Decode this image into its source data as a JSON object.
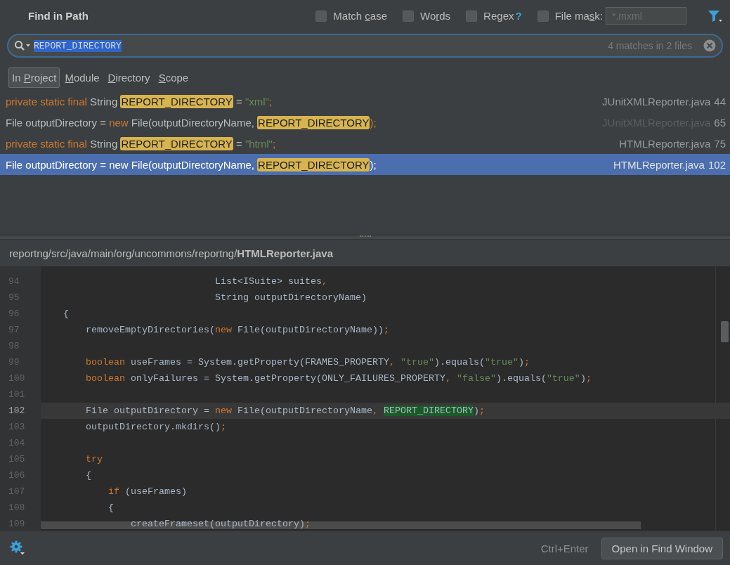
{
  "dialog": {
    "title": "Find in Path"
  },
  "options": [
    {
      "label": {
        "before": "Match ",
        "key": "c",
        "after": "ase"
      },
      "checked": false
    },
    {
      "label": {
        "before": "Wo",
        "key": "r",
        "after": "ds"
      },
      "checked": false
    },
    {
      "label": {
        "before": "Re",
        "key": "g",
        "after": "ex"
      },
      "checked": false,
      "help": "?"
    },
    {
      "label": {
        "before": "File ma",
        "key": "s",
        "after": "k:"
      },
      "checked": false
    }
  ],
  "file_mask": {
    "placeholder": "*.mxml"
  },
  "search": {
    "value": "REPORT_DIRECTORY",
    "match_count": "4 matches in 2 files"
  },
  "scopes": [
    {
      "label": {
        "before": "In ",
        "key": "P",
        "after": "roject"
      },
      "selected": true
    },
    {
      "label": {
        "key": "M",
        "after": "odule"
      },
      "selected": false
    },
    {
      "label": {
        "key": "D",
        "after": "irectory"
      },
      "selected": false
    },
    {
      "label": {
        "key": "S",
        "after": "cope"
      },
      "selected": false
    }
  ],
  "results": [
    {
      "selected": false,
      "file_dimmed": false,
      "file": "JUnitXMLReporter.java",
      "line": "44",
      "tokens": [
        {
          "kind": "keyword",
          "text": "private static final "
        },
        {
          "kind": "plain",
          "text": "String "
        },
        {
          "kind": "match",
          "text": "REPORT_DIRECTORY"
        },
        {
          "kind": "plain",
          "text": " = "
        },
        {
          "kind": "string",
          "text": "\"xml\""
        },
        {
          "kind": "punct",
          "text": ";"
        }
      ]
    },
    {
      "selected": false,
      "file_dimmed": true,
      "file": "JUnitXMLReporter.java",
      "line": "65",
      "tokens": [
        {
          "kind": "plain",
          "text": "File outputDirectory = "
        },
        {
          "kind": "keyword",
          "text": "new"
        },
        {
          "kind": "plain",
          "text": " File(outputDirectoryName, "
        },
        {
          "kind": "match",
          "text": "REPORT_DIRECTORY"
        },
        {
          "kind": "punct",
          "text": ");"
        }
      ]
    },
    {
      "selected": false,
      "file_dimmed": false,
      "file": "HTMLReporter.java",
      "line": "75",
      "tokens": [
        {
          "kind": "keyword",
          "text": "private static final "
        },
        {
          "kind": "plain",
          "text": "String "
        },
        {
          "kind": "match",
          "text": "REPORT_DIRECTORY"
        },
        {
          "kind": "plain",
          "text": " = "
        },
        {
          "kind": "string",
          "text": "\"html\""
        },
        {
          "kind": "punct",
          "text": ";"
        }
      ]
    },
    {
      "selected": true,
      "file_dimmed": false,
      "file": "HTMLReporter.java",
      "line": "102",
      "tokens": [
        {
          "kind": "plain",
          "text": "File outputDirectory = "
        },
        {
          "kind": "keyword",
          "text": "new"
        },
        {
          "kind": "plain",
          "text": " File(outputDirectoryName, "
        },
        {
          "kind": "match",
          "text": "REPORT_DIRECTORY"
        },
        {
          "kind": "punct",
          "text": ");"
        }
      ]
    }
  ],
  "preview": {
    "path": "reportng/src/java/main/org/uncommons/reportng/**HTMLReporter.java**"
  },
  "code": [
    {
      "number": "94",
      "current": false,
      "tokens": [
        {
          "kind": "plain",
          "text": "                               List<ISuite> suites"
        },
        {
          "kind": "punct",
          "text": ","
        }
      ]
    },
    {
      "number": "95",
      "current": false,
      "tokens": [
        {
          "kind": "plain",
          "text": "                               String outputDirectoryName)"
        }
      ]
    },
    {
      "number": "96",
      "current": false,
      "tokens": [
        {
          "kind": "plain",
          "text": "    {"
        }
      ]
    },
    {
      "number": "97",
      "current": false,
      "tokens": [
        {
          "kind": "plain",
          "text": "        removeEmptyDirectories("
        },
        {
          "kind": "keyword",
          "text": "new"
        },
        {
          "kind": "plain",
          "text": " File(outputDirectoryName))"
        },
        {
          "kind": "punct",
          "text": ";"
        }
      ]
    },
    {
      "number": "98",
      "current": false
    },
    {
      "number": "99",
      "current": false,
      "tokens": [
        {
          "kind": "keyword",
          "text": "        boolean"
        },
        {
          "kind": "plain",
          "text": " useFrames = System.getProperty(FRAMES_PROPERTY"
        },
        {
          "kind": "punct",
          "text": ", "
        },
        {
          "kind": "string",
          "text": "\"true\""
        },
        {
          "kind": "plain",
          "text": ").equals("
        },
        {
          "kind": "string",
          "text": "\"true\""
        },
        {
          "kind": "plain",
          "text": ")"
        },
        {
          "kind": "punct",
          "text": ";"
        }
      ]
    },
    {
      "number": "100",
      "current": false,
      "tokens": [
        {
          "kind": "keyword",
          "text": "        boolean"
        },
        {
          "kind": "plain",
          "text": " onlyFailures = System.getProperty(ONLY_FAILURES_PROPERTY"
        },
        {
          "kind": "punct",
          "text": ", "
        },
        {
          "kind": "string",
          "text": "\"false\""
        },
        {
          "kind": "plain",
          "text": ").equals("
        },
        {
          "kind": "string",
          "text": "\"true\""
        },
        {
          "kind": "plain",
          "text": ")"
        },
        {
          "kind": "punct",
          "text": ";"
        }
      ]
    },
    {
      "number": "101",
      "current": false
    },
    {
      "number": "102",
      "current": true,
      "tokens": [
        {
          "kind": "plain",
          "text": "        File outputDirectory = "
        },
        {
          "kind": "keyword",
          "text": "new"
        },
        {
          "kind": "plain",
          "text": " File(outputDirectoryName"
        },
        {
          "kind": "punct",
          "text": ", "
        },
        {
          "kind": "match",
          "text": "REPORT_DIRECTORY"
        },
        {
          "kind": "plain",
          "text": ")"
        },
        {
          "kind": "punct",
          "text": ";"
        }
      ]
    },
    {
      "number": "103",
      "current": false,
      "tokens": [
        {
          "kind": "plain",
          "text": "        outputDirectory.mkdirs()"
        },
        {
          "kind": "punct",
          "text": ";"
        }
      ]
    },
    {
      "number": "104",
      "current": false
    },
    {
      "number": "105",
      "current": false,
      "tokens": [
        {
          "kind": "keyword",
          "text": "        try"
        }
      ]
    },
    {
      "number": "106",
      "current": false,
      "tokens": [
        {
          "kind": "plain",
          "text": "        {"
        }
      ]
    },
    {
      "number": "107",
      "current": false,
      "tokens": [
        {
          "kind": "keyword",
          "text": "            if"
        },
        {
          "kind": "plain",
          "text": " (useFrames)"
        }
      ]
    },
    {
      "number": "108",
      "current": false,
      "tokens": [
        {
          "kind": "plain",
          "text": "            {"
        }
      ]
    },
    {
      "number": "109",
      "current": false,
      "tokens": [
        {
          "kind": "plain",
          "text": "                createFrameset(outputDirectory)"
        },
        {
          "kind": "punct",
          "text": ";"
        }
      ]
    }
  ],
  "footer": {
    "shortcut": "Ctrl+Enter",
    "button": "Open in Find Window"
  }
}
